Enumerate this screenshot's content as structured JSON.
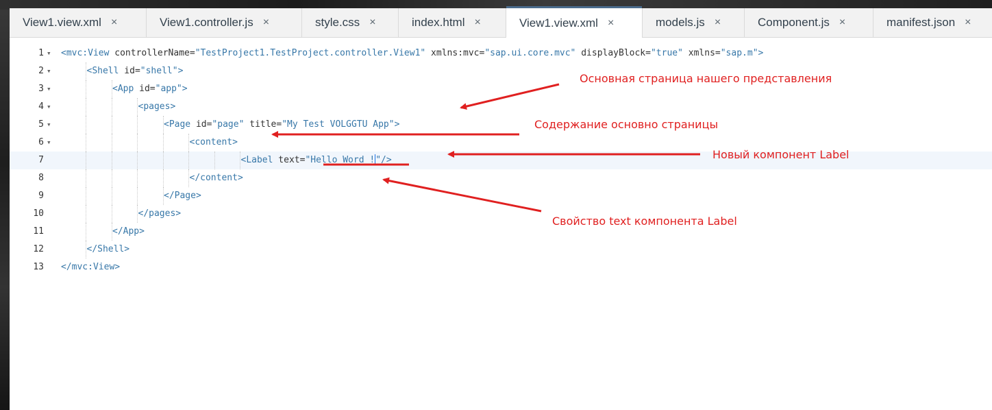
{
  "tabs": [
    {
      "label": "View1.view.xml",
      "active": false
    },
    {
      "label": "View1.controller.js",
      "active": false
    },
    {
      "label": "style.css",
      "active": false
    },
    {
      "label": "index.html",
      "active": false
    },
    {
      "label": "View1.view.xml",
      "active": true
    },
    {
      "label": "models.js",
      "active": false
    },
    {
      "label": "Component.js",
      "active": false
    },
    {
      "label": "manifest.json",
      "active": false
    }
  ],
  "close_glyph": "×",
  "fold_glyph": "▾",
  "editor": {
    "current_line": 7,
    "lines": [
      {
        "num": "1",
        "fold": true,
        "tokens": [
          [
            "tag",
            "<mvc:View"
          ],
          [
            "attr",
            " controllerName="
          ],
          [
            "val",
            "\"TestProject1.TestProject.controller.View1\""
          ],
          [
            "attr",
            " xmlns:mvc="
          ],
          [
            "val",
            "\"sap.ui.core.mvc\""
          ],
          [
            "attr",
            " displayBlock="
          ],
          [
            "val",
            "\"true\""
          ],
          [
            "attr",
            " xmlns="
          ],
          [
            "val",
            "\"sap.m\""
          ],
          [
            "tag",
            ">"
          ]
        ]
      },
      {
        "num": "2",
        "fold": true,
        "tokens": [
          [
            "tag",
            "<Shell"
          ],
          [
            "attr",
            " id="
          ],
          [
            "val",
            "\"shell\""
          ],
          [
            "tag",
            ">"
          ]
        ]
      },
      {
        "num": "3",
        "fold": true,
        "tokens": [
          [
            "tag",
            "<App"
          ],
          [
            "attr",
            " id="
          ],
          [
            "val",
            "\"app\""
          ],
          [
            "tag",
            ">"
          ]
        ]
      },
      {
        "num": "4",
        "fold": true,
        "tokens": [
          [
            "tag",
            "<pages>"
          ]
        ]
      },
      {
        "num": "5",
        "fold": true,
        "tokens": [
          [
            "tag",
            "<Page"
          ],
          [
            "attr",
            " id="
          ],
          [
            "val",
            "\"page\""
          ],
          [
            "attr",
            " title="
          ],
          [
            "val",
            "\"My Test VOLGGTU App\""
          ],
          [
            "tag",
            ">"
          ]
        ]
      },
      {
        "num": "6",
        "fold": true,
        "tokens": [
          [
            "tag",
            "<content>"
          ]
        ]
      },
      {
        "num": "7",
        "fold": false,
        "tokens": [
          [
            "tag",
            "<Label"
          ],
          [
            "attr",
            " text="
          ],
          [
            "val",
            "\"Hello Word !"
          ],
          [
            "cursor",
            ""
          ],
          [
            "val",
            "\""
          ],
          [
            "tag",
            "/>"
          ]
        ]
      },
      {
        "num": "8",
        "fold": false,
        "tokens": [
          [
            "tag",
            "</content>"
          ]
        ]
      },
      {
        "num": "9",
        "fold": false,
        "tokens": [
          [
            "tag",
            "</Page>"
          ]
        ]
      },
      {
        "num": "10",
        "fold": false,
        "tokens": [
          [
            "tag",
            "</pages>"
          ]
        ]
      },
      {
        "num": "11",
        "fold": false,
        "tokens": [
          [
            "tag",
            "</App>"
          ]
        ]
      },
      {
        "num": "12",
        "fold": false,
        "tokens": [
          [
            "tag",
            "</Shell>"
          ]
        ]
      },
      {
        "num": "13",
        "fold": false,
        "tokens": [
          [
            "tag",
            "</mvc:View>"
          ]
        ]
      }
    ]
  },
  "annotations": {
    "page_note": "Основная страница нашего представления",
    "content_note": "Содержание основно страницы",
    "label_note": "Новый компонент Label",
    "text_prop_note": "Свойство text компонента Label"
  },
  "colors": {
    "annotation_red": "#e02020",
    "xml_tag": "#3777a8",
    "active_tab_indicator": "#4a6b8c"
  }
}
